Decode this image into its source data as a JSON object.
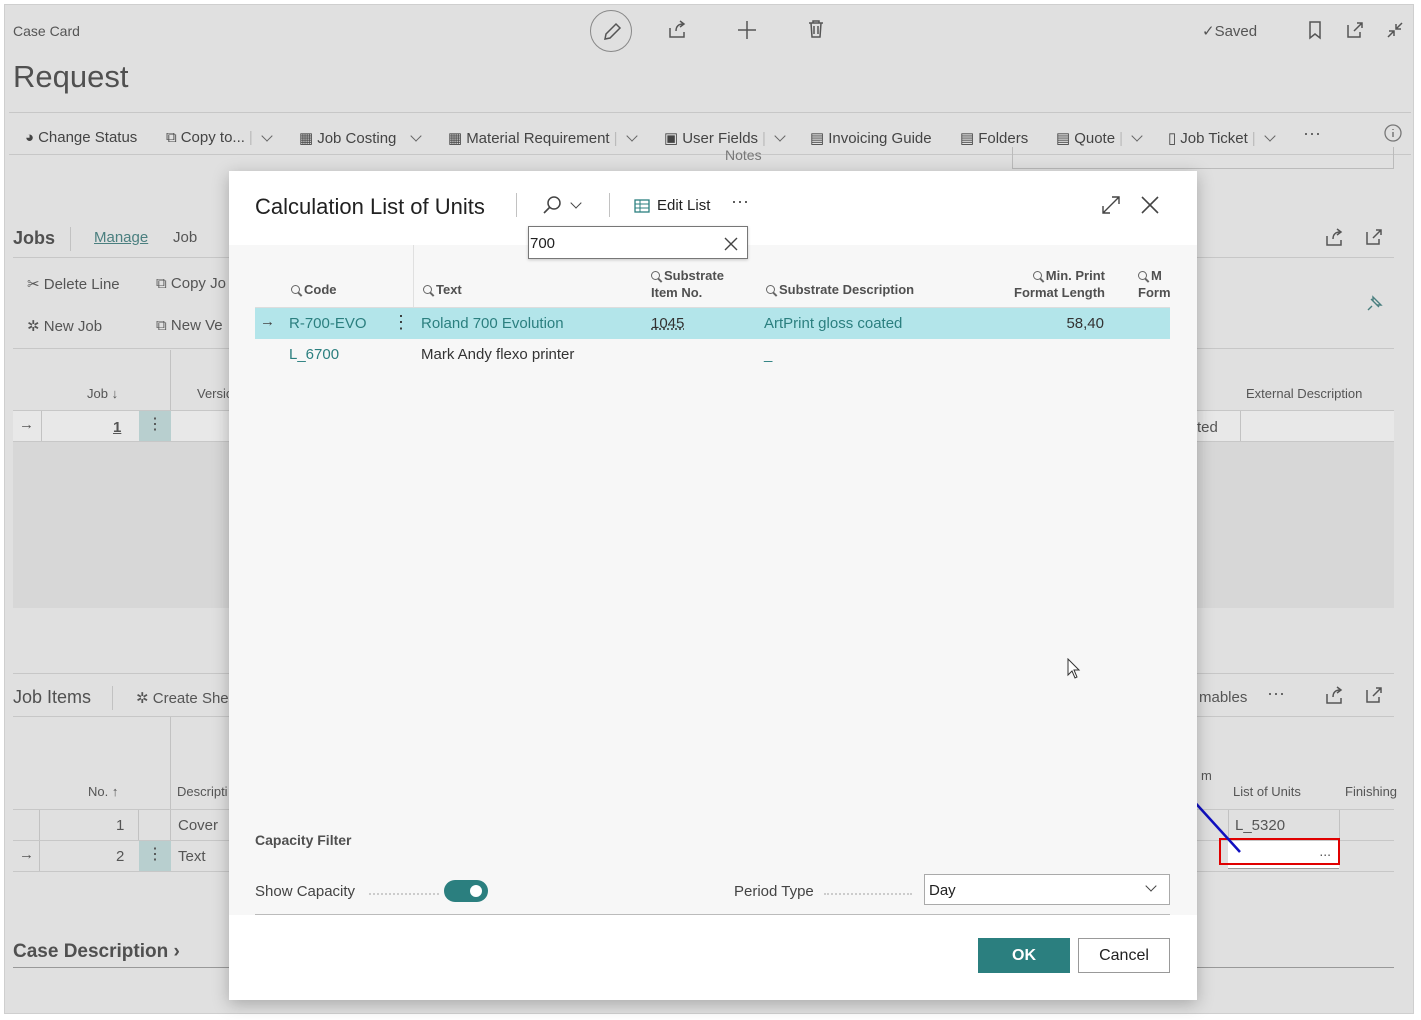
{
  "page": {
    "breadcrumb": "Case Card",
    "title": "Request",
    "saved_label": "Saved"
  },
  "actions": [
    "Change Status",
    "Copy to...",
    "Job Costing",
    "Material Requirement",
    "User Fields",
    "Invoicing Guide",
    "Folders",
    "Quote",
    "Job Ticket"
  ],
  "notes_label": "Notes",
  "jobs": {
    "title": "Jobs",
    "tab_manage": "Manage",
    "tab_job": "Job",
    "delete_line": "Delete Line",
    "copy_job": "Copy Jo",
    "new_job": "New Job",
    "new_version": "New Ve",
    "col_job": "Job",
    "col_version": "Versio",
    "col_external": "External Description",
    "row_job": "1",
    "row_status_partial": "ted"
  },
  "job_items": {
    "title": "Job Items",
    "create_sheet": "Create She",
    "consumables_partial": "mables",
    "col_no": "No.",
    "col_description": "Descripti",
    "col_list_of_units": "List of Units",
    "col_finishing": "Finishing",
    "col_partial_m": "m",
    "rows": [
      {
        "no": "1",
        "desc": "Cover",
        "units": "L_5320"
      },
      {
        "no": "2",
        "desc": "Text",
        "units": ""
      }
    ],
    "ellipsis": "..."
  },
  "case_description": "Case Description",
  "dialog": {
    "title": "Calculation List of Units",
    "edit_list": "Edit List",
    "search_value": "700",
    "columns": {
      "code": "Code",
      "text": "Text",
      "substrate_item_1": "Substrate",
      "substrate_item_2": "Item No.",
      "substrate_desc": "Substrate Description",
      "min_print_1": "Min. Print",
      "min_print_2": "Format Length",
      "next_1": "M",
      "next_2": "Form"
    },
    "rows": [
      {
        "code": "R-700-EVO",
        "text": "Roland 700 Evolution",
        "item_no": "1045",
        "substrate_desc": "ArtPrint gloss coated",
        "min_print": "58,40"
      },
      {
        "code": "L_6700",
        "text": "Mark Andy flexo printer",
        "item_no": "",
        "substrate_desc": "_",
        "min_print": ""
      }
    ],
    "capacity_filter": "Capacity Filter",
    "show_capacity": "Show Capacity",
    "show_capacity_on": true,
    "period_type_label": "Period Type",
    "period_type_value": "Day",
    "ok": "OK",
    "cancel": "Cancel"
  },
  "colors": {
    "accent": "#2b7f7f",
    "selected_row": "#b3e5ea",
    "link": "#2b7f7f",
    "arrow": "#1010c0",
    "highlight_box": "#e00000"
  }
}
